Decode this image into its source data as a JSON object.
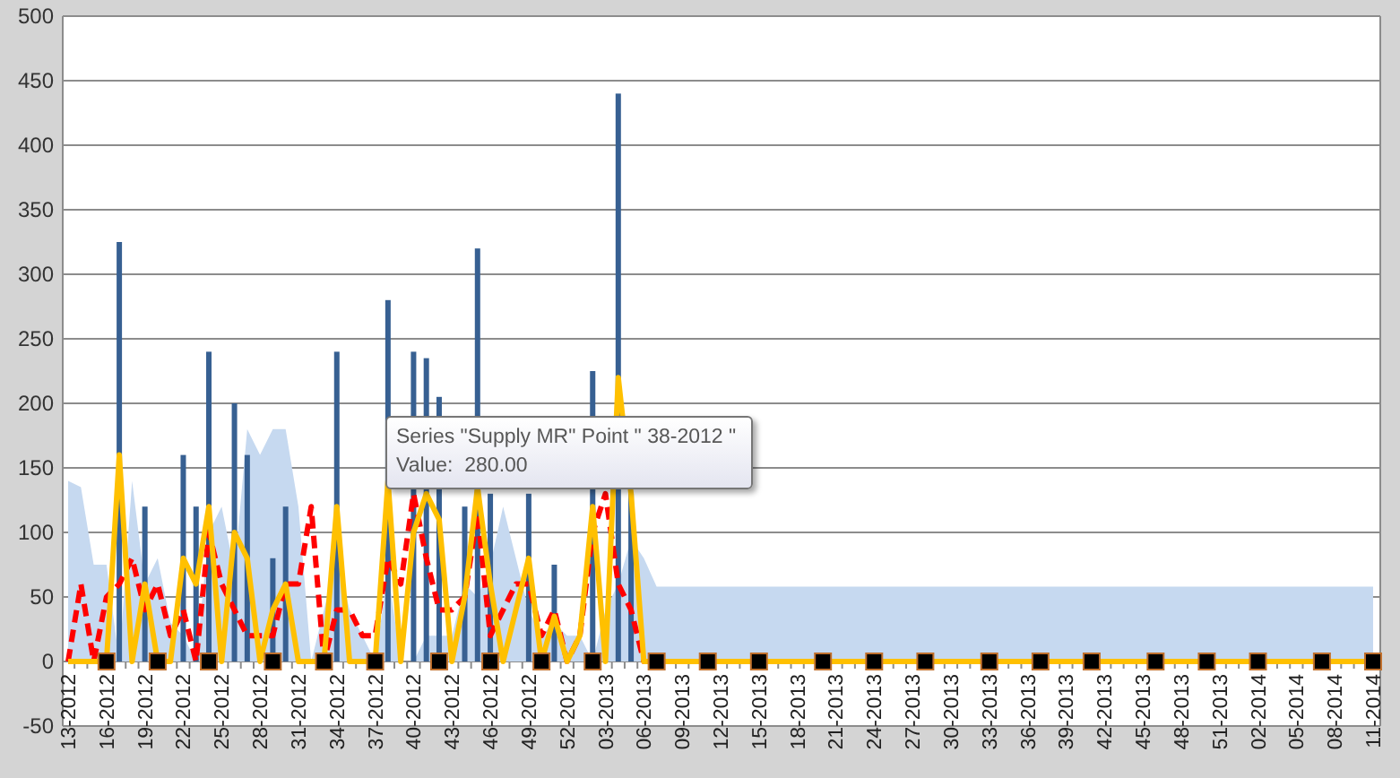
{
  "chart_data": {
    "type": "bar",
    "grid": true,
    "ylim": [
      -50,
      500
    ],
    "categories": [
      "13-2012",
      null,
      null,
      "16-2012",
      null,
      null,
      "19-2012",
      null,
      null,
      "22-2012",
      null,
      null,
      "25-2012",
      null,
      null,
      "28-2012",
      null,
      null,
      "31-2012",
      null,
      null,
      "34-2012",
      null,
      null,
      "37-2012",
      null,
      null,
      "40-2012",
      null,
      null,
      "43-2012",
      null,
      null,
      "46-2012",
      null,
      null,
      "49-2012",
      null,
      null,
      "52-2012",
      null,
      null,
      "03-2013",
      null,
      null,
      "06-2013",
      null,
      null,
      "09-2013",
      null,
      null,
      "12-2013",
      null,
      null,
      "15-2013",
      null,
      null,
      "18-2013",
      null,
      null,
      "21-2013",
      null,
      null,
      "24-2013",
      null,
      null,
      "27-2013",
      null,
      null,
      "30-2013",
      null,
      null,
      "33-2013",
      null,
      null,
      "36-2013",
      null,
      null,
      "39-2013",
      null,
      null,
      "42-2013",
      null,
      null,
      "45-2013",
      null,
      null,
      "48-2013",
      null,
      null,
      "51-2013",
      null,
      null,
      "02-2014",
      null,
      null,
      "05-2014",
      null,
      null,
      "08-2014",
      null,
      null,
      "11-2014"
    ],
    "yticks": [
      -50,
      0,
      50,
      100,
      150,
      200,
      250,
      300,
      350,
      400,
      450,
      500
    ],
    "series": [
      {
        "type": "area",
        "color": "#c6d9f0",
        "values": [
          140,
          135,
          75,
          75,
          0,
          140,
          60,
          80,
          30,
          20,
          0,
          100,
          120,
          70,
          180,
          160,
          180,
          180,
          120,
          0,
          40,
          80,
          40,
          20,
          0,
          70,
          0,
          0,
          20,
          20,
          20,
          60,
          50,
          75,
          120,
          80,
          40,
          20,
          30,
          20,
          20,
          0,
          40,
          60,
          95,
          80,
          58,
          58,
          58,
          58,
          58,
          58,
          58,
          58,
          58,
          58,
          58,
          58,
          58,
          58,
          58,
          58,
          58,
          58,
          58,
          58,
          58,
          58,
          58,
          58,
          58,
          58,
          58,
          58,
          58,
          58,
          58,
          58,
          58,
          58,
          58,
          58,
          58,
          58,
          58,
          58,
          58,
          58,
          58,
          58,
          58,
          58,
          58,
          58,
          58,
          58,
          58,
          58,
          58,
          58,
          58,
          58,
          58
        ]
      },
      {
        "color": "#376092",
        "values": [
          null,
          null,
          null,
          null,
          325,
          null,
          120,
          null,
          null,
          160,
          120,
          240,
          null,
          200,
          160,
          null,
          80,
          120,
          null,
          null,
          null,
          240,
          null,
          null,
          null,
          280,
          null,
          240,
          235,
          205,
          null,
          120,
          320,
          130,
          null,
          null,
          130,
          null,
          75,
          null,
          null,
          225,
          null,
          440,
          130,
          null,
          null,
          null,
          null,
          null,
          null,
          null,
          null,
          null,
          null,
          null,
          null,
          null,
          null,
          null,
          null,
          null,
          null,
          null,
          null,
          null,
          null,
          null,
          null,
          null,
          null,
          null,
          null,
          null,
          null,
          null,
          null,
          null,
          null,
          null,
          null,
          null,
          null,
          null,
          null,
          null,
          null,
          null,
          null,
          null,
          null,
          null,
          null,
          null,
          null,
          null,
          null,
          null,
          null,
          null,
          null,
          null,
          null
        ]
      },
      {
        "type": "line",
        "line_style": "dashed",
        "color": "#ff0000",
        "values": [
          0,
          60,
          0,
          50,
          60,
          80,
          40,
          60,
          20,
          40,
          0,
          100,
          60,
          40,
          20,
          20,
          20,
          60,
          60,
          120,
          0,
          40,
          40,
          20,
          20,
          80,
          60,
          130,
          80,
          40,
          40,
          50,
          115,
          20,
          40,
          60,
          60,
          20,
          40,
          0,
          20,
          100,
          130,
          60,
          40,
          0,
          0,
          null,
          null,
          null,
          null,
          null,
          null,
          null,
          null,
          null,
          null,
          null,
          null,
          null,
          null,
          null,
          null,
          null,
          null,
          null,
          null,
          null,
          null,
          null,
          null,
          null,
          null,
          null,
          null,
          null,
          null,
          null,
          null,
          null,
          null,
          null,
          null,
          null,
          null,
          null,
          null,
          null,
          null,
          null,
          null,
          null,
          null,
          null,
          null,
          null,
          null,
          null,
          null,
          null,
          null,
          null,
          null
        ]
      },
      {
        "type": "line",
        "line_style": "solid",
        "color": "#ffc000",
        "values": [
          0,
          0,
          0,
          0,
          160,
          0,
          60,
          0,
          0,
          80,
          60,
          120,
          0,
          100,
          80,
          0,
          40,
          60,
          0,
          0,
          0,
          120,
          0,
          0,
          0,
          140,
          0,
          100,
          130,
          110,
          0,
          50,
          135,
          60,
          0,
          40,
          80,
          0,
          35,
          0,
          20,
          120,
          0,
          220,
          130,
          0,
          0,
          0,
          0,
          0,
          0,
          0,
          0,
          0,
          0,
          0,
          0,
          0,
          0,
          0,
          0,
          0,
          0,
          0,
          0,
          0,
          0,
          0,
          0,
          0,
          0,
          0,
          0,
          0,
          0,
          0,
          0,
          0,
          0,
          0,
          0,
          0,
          0,
          0,
          0,
          0,
          0,
          0,
          0,
          0,
          0,
          0,
          0,
          0,
          0,
          0,
          0,
          0,
          0,
          0,
          0,
          0,
          0
        ]
      },
      {
        "type": "scatter",
        "color": "#000000",
        "values": [
          null,
          null,
          null,
          0,
          null,
          null,
          null,
          0,
          null,
          null,
          null,
          0,
          null,
          null,
          null,
          null,
          0,
          null,
          null,
          null,
          0,
          null,
          null,
          null,
          0,
          null,
          null,
          null,
          null,
          0,
          null,
          null,
          null,
          0,
          null,
          null,
          null,
          0,
          null,
          null,
          null,
          0,
          null,
          null,
          null,
          null,
          0,
          null,
          null,
          null,
          0,
          null,
          null,
          null,
          0,
          null,
          null,
          null,
          null,
          0,
          null,
          null,
          null,
          0,
          null,
          null,
          null,
          0,
          null,
          null,
          null,
          null,
          0,
          null,
          null,
          null,
          0,
          null,
          null,
          null,
          0,
          null,
          null,
          null,
          null,
          0,
          null,
          null,
          null,
          0,
          null,
          null,
          null,
          0,
          null,
          null,
          null,
          null,
          0,
          null,
          null,
          null,
          0
        ]
      }
    ]
  },
  "tooltip": {
    "line_1": "Series \"Supply MR\" Point \" 38-2012 \"",
    "line_2": "Value:  280.00"
  }
}
